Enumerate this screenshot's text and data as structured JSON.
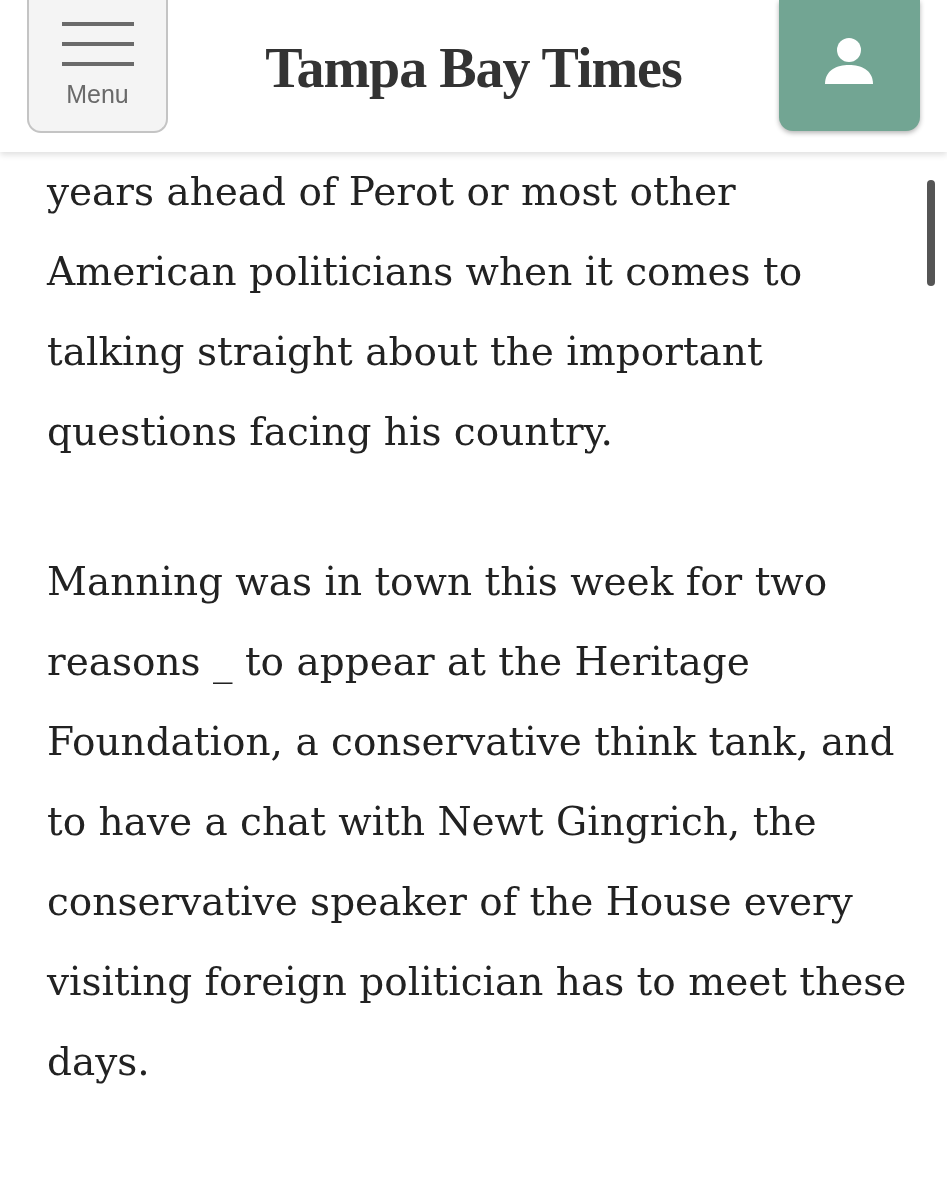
{
  "header": {
    "menu_button": {
      "label": "Menu"
    },
    "logo": "Tampa Bay Times"
  },
  "article": {
    "paragraphs": [
      "years ahead of Perot or most other American politicians when it comes to talking straight about the important questions facing his country.",
      "Manning was in town this week for two reasons _ to appear at the Heritage Foundation, a conservative think tank, and to have a chat with Newt Gingrich, the conservative speaker of the House every visiting foreign politician has to meet these days."
    ]
  }
}
